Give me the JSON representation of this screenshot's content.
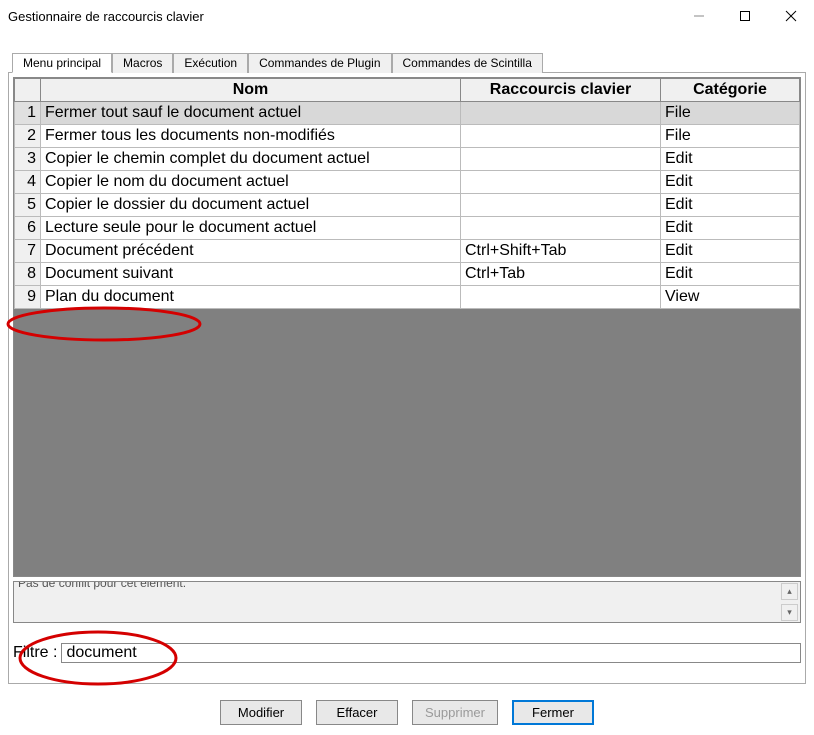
{
  "window": {
    "title": "Gestionnaire de raccourcis clavier"
  },
  "tabs": [
    {
      "label": "Menu principal",
      "active": true
    },
    {
      "label": "Macros",
      "active": false
    },
    {
      "label": "Exécution",
      "active": false
    },
    {
      "label": "Commandes de Plugin",
      "active": false
    },
    {
      "label": "Commandes de Scintilla",
      "active": false
    }
  ],
  "columns": {
    "name": "Nom",
    "shortcut": "Raccourcis clavier",
    "category": "Catégorie"
  },
  "rows": [
    {
      "n": "1",
      "name": "Fermer tout sauf le document actuel",
      "shortcut": "",
      "category": "File",
      "selected": true
    },
    {
      "n": "2",
      "name": "Fermer tous les documents non-modifiés",
      "shortcut": "",
      "category": "File",
      "selected": false
    },
    {
      "n": "3",
      "name": "Copier le chemin complet du document actuel",
      "shortcut": "",
      "category": "Edit",
      "selected": false
    },
    {
      "n": "4",
      "name": "Copier le nom du document actuel",
      "shortcut": "",
      "category": "Edit",
      "selected": false
    },
    {
      "n": "5",
      "name": "Copier le dossier du document actuel",
      "shortcut": "",
      "category": "Edit",
      "selected": false
    },
    {
      "n": "6",
      "name": "Lecture seule pour le document actuel",
      "shortcut": "",
      "category": "Edit",
      "selected": false
    },
    {
      "n": "7",
      "name": "Document précédent",
      "shortcut": "Ctrl+Shift+Tab",
      "category": "Edit",
      "selected": false
    },
    {
      "n": "8",
      "name": "Document suivant",
      "shortcut": "Ctrl+Tab",
      "category": "Edit",
      "selected": false
    },
    {
      "n": "9",
      "name": "Plan du document",
      "shortcut": "",
      "category": "View",
      "selected": false
    }
  ],
  "status": "Pas de conflit pour cet élément.",
  "filter": {
    "label": "Filtre :",
    "value": "document"
  },
  "buttons": {
    "modify": "Modifier",
    "clear": "Effacer",
    "delete": "Supprimer",
    "close": "Fermer"
  }
}
